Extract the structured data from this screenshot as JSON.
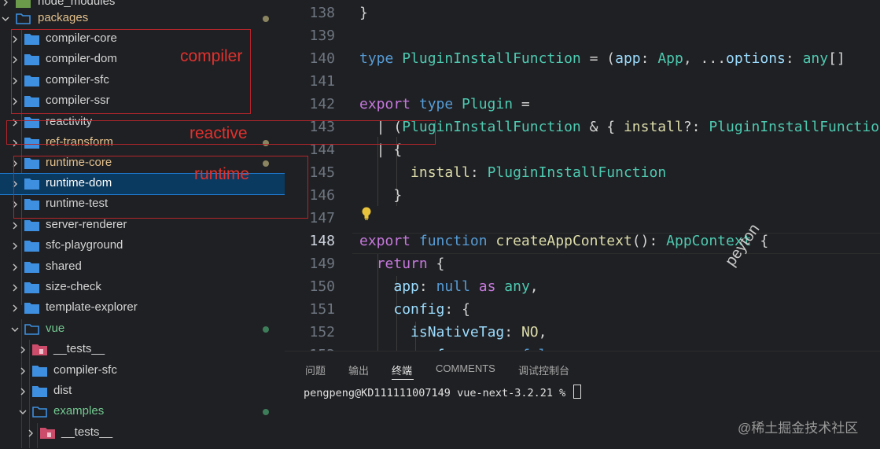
{
  "colors": {
    "folder": "#3f8fe0",
    "test_folder": "#cc4c6b",
    "modified_text": "#e2c08d",
    "added_text": "#73c991",
    "modified_dot": "#8b8460",
    "added_dot": "#3e7d5a",
    "annotation": "#e0312e",
    "selection": "#0b3a60"
  },
  "explorer": {
    "rows": [
      {
        "label": "node_modules",
        "expanded": false,
        "icon": "node-modules-folder-icon"
      },
      {
        "label": "packages",
        "expanded": true,
        "icon": "folder-open-icon",
        "status": "modified"
      },
      {
        "label": "compiler-core",
        "expanded": false,
        "icon": "folder-icon"
      },
      {
        "label": "compiler-dom",
        "expanded": false,
        "icon": "folder-icon"
      },
      {
        "label": "compiler-sfc",
        "expanded": false,
        "icon": "folder-icon"
      },
      {
        "label": "compiler-ssr",
        "expanded": false,
        "icon": "folder-icon"
      },
      {
        "label": "reactivity",
        "expanded": false,
        "icon": "folder-icon"
      },
      {
        "label": "ref-transform",
        "expanded": false,
        "icon": "folder-icon",
        "status": "modified"
      },
      {
        "label": "runtime-core",
        "expanded": false,
        "icon": "folder-icon",
        "status": "modified"
      },
      {
        "label": "runtime-dom",
        "expanded": false,
        "icon": "folder-icon",
        "selected": true
      },
      {
        "label": "runtime-test",
        "expanded": false,
        "icon": "folder-icon"
      },
      {
        "label": "server-renderer",
        "expanded": false,
        "icon": "folder-icon"
      },
      {
        "label": "sfc-playground",
        "expanded": false,
        "icon": "folder-icon"
      },
      {
        "label": "shared",
        "expanded": false,
        "icon": "folder-icon"
      },
      {
        "label": "size-check",
        "expanded": false,
        "icon": "folder-icon"
      },
      {
        "label": "template-explorer",
        "expanded": false,
        "icon": "folder-icon"
      },
      {
        "label": "vue",
        "expanded": true,
        "icon": "folder-open-icon",
        "status": "added"
      },
      {
        "label": "__tests__",
        "expanded": false,
        "icon": "test-folder-icon"
      },
      {
        "label": "compiler-sfc",
        "expanded": false,
        "icon": "folder-icon"
      },
      {
        "label": "dist",
        "expanded": false,
        "icon": "folder-icon"
      },
      {
        "label": "examples",
        "expanded": true,
        "icon": "folder-open-icon",
        "status": "added"
      },
      {
        "label": "__tests__",
        "expanded": false,
        "icon": "test-folder-icon"
      }
    ]
  },
  "annotations": {
    "compiler": "compiler",
    "reactive": "reactive",
    "runtime": "runtime"
  },
  "editor": {
    "lines": [
      {
        "num": "138",
        "tokens": [
          [
            "op",
            "}"
          ]
        ]
      },
      {
        "num": "139",
        "tokens": []
      },
      {
        "num": "140",
        "tokens": [
          [
            "cn",
            "type "
          ],
          [
            "ty",
            "PluginInstallFunction"
          ],
          [
            "op",
            " = ("
          ],
          [
            "pr",
            "app"
          ],
          [
            "op",
            ": "
          ],
          [
            "ty",
            "App"
          ],
          [
            "op",
            ", ..."
          ],
          [
            "pr",
            "options"
          ],
          [
            "op",
            ": "
          ],
          [
            "ty",
            "any"
          ],
          [
            "op",
            "[]"
          ]
        ]
      },
      {
        "num": "141",
        "tokens": []
      },
      {
        "num": "142",
        "tokens": [
          [
            "kw",
            "export "
          ],
          [
            "cn",
            "type "
          ],
          [
            "ty",
            "Plugin"
          ],
          [
            "op",
            " ="
          ]
        ]
      },
      {
        "num": "143",
        "tokens": [
          [
            "op",
            "  | ("
          ],
          [
            "ty",
            "PluginInstallFunction"
          ],
          [
            "op",
            " & { "
          ],
          [
            "fn",
            "install"
          ],
          [
            "op",
            "?: "
          ],
          [
            "ty",
            "PluginInstallFunction"
          ]
        ]
      },
      {
        "num": "144",
        "tokens": [
          [
            "op",
            "  | {"
          ]
        ]
      },
      {
        "num": "145",
        "tokens": [
          [
            "op",
            "      "
          ],
          [
            "fn",
            "install"
          ],
          [
            "op",
            ": "
          ],
          [
            "ty",
            "PluginInstallFunction"
          ]
        ]
      },
      {
        "num": "146",
        "tokens": [
          [
            "op",
            "    }"
          ]
        ]
      },
      {
        "num": "147",
        "tokens": []
      },
      {
        "num": "148",
        "tokens": [
          [
            "kw",
            "export "
          ],
          [
            "cn",
            "function "
          ],
          [
            "fn",
            "createAppContext"
          ],
          [
            "op",
            "(): "
          ],
          [
            "ty",
            "AppContext"
          ],
          [
            "op",
            " {"
          ]
        ],
        "active": true
      },
      {
        "num": "149",
        "tokens": [
          [
            "op",
            "  "
          ],
          [
            "kw",
            "return"
          ],
          [
            "op",
            " {"
          ]
        ]
      },
      {
        "num": "150",
        "tokens": [
          [
            "op",
            "    "
          ],
          [
            "pr",
            "app"
          ],
          [
            "op",
            ": "
          ],
          [
            "cn",
            "null "
          ],
          [
            "kw",
            "as "
          ],
          [
            "ty",
            "any"
          ],
          [
            "op",
            ","
          ]
        ]
      },
      {
        "num": "151",
        "tokens": [
          [
            "op",
            "    "
          ],
          [
            "pr",
            "config"
          ],
          [
            "op",
            ": {"
          ]
        ]
      },
      {
        "num": "152",
        "tokens": [
          [
            "op",
            "      "
          ],
          [
            "pr",
            "isNativeTag"
          ],
          [
            "op",
            ": "
          ],
          [
            "fn",
            "NO"
          ],
          [
            "op",
            ","
          ]
        ]
      },
      {
        "num": "153",
        "tokens": [
          [
            "op",
            "      "
          ],
          [
            "pr",
            "performance"
          ],
          [
            "op",
            ": "
          ],
          [
            "cn",
            "false"
          ]
        ]
      }
    ]
  },
  "panel": {
    "tabs": [
      "问题",
      "输出",
      "终端",
      "COMMENTS",
      "调试控制台"
    ],
    "active_tab": "终端",
    "terminal_prompt": "pengpeng@KD111111007149 vue-next-3.2.21 % "
  },
  "watermarks": {
    "author": "peyton",
    "site": "@稀土掘金技术社区"
  }
}
